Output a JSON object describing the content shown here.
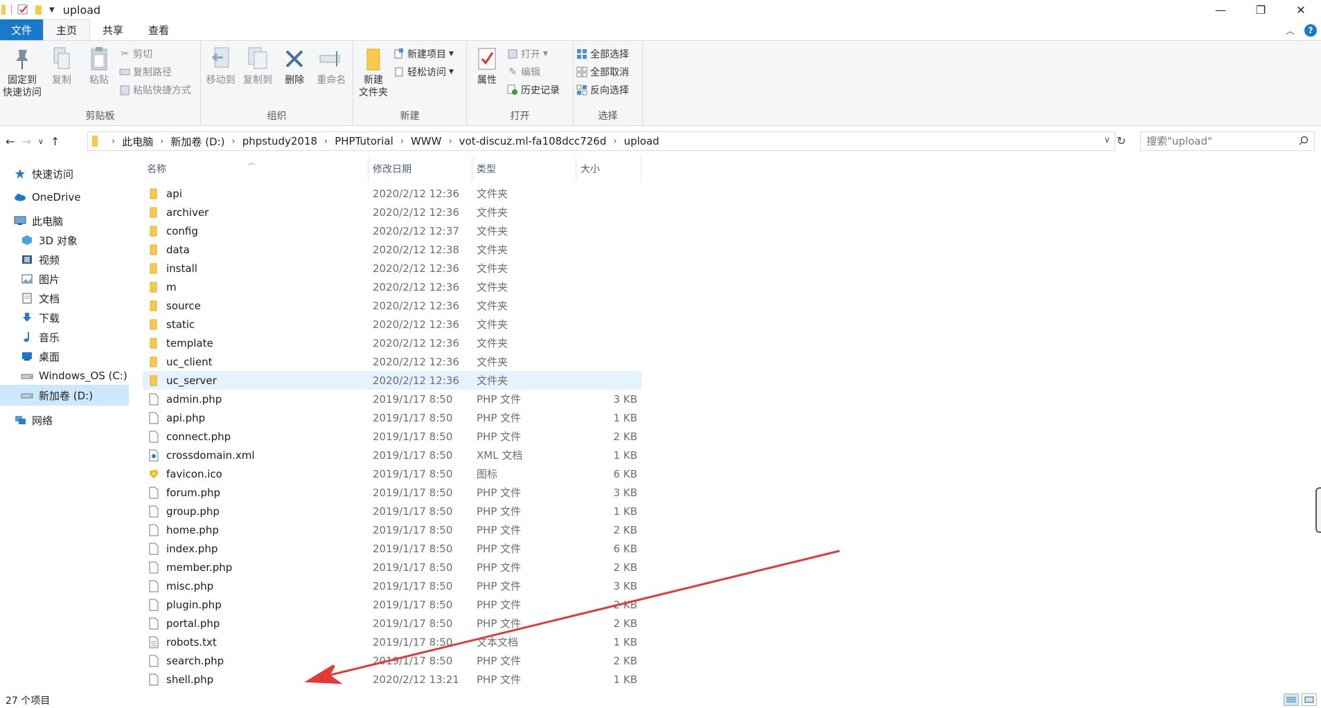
{
  "window": {
    "title": "upload",
    "minimize": "—",
    "maximize": "❐",
    "close": "✕"
  },
  "tabs": [
    {
      "label": "文件"
    },
    {
      "label": "主页"
    },
    {
      "label": "共享"
    },
    {
      "label": "查看"
    }
  ],
  "ribbon": {
    "clipboard": {
      "label": "剪贴板",
      "pin": "固定到\n快速访问",
      "copy": "复制",
      "paste": "粘贴",
      "cut": "剪切",
      "copy_path": "复制路径",
      "paste_shortcut": "粘贴快捷方式"
    },
    "organize": {
      "label": "组织",
      "move_to": "移动到",
      "copy_to": "复制到",
      "delete": "删除",
      "rename": "重命名"
    },
    "new": {
      "label": "新建",
      "new_folder": "新建\n文件夹",
      "new_item": "新建项目",
      "easy_access": "轻松访问"
    },
    "open": {
      "label": "打开",
      "properties": "属性",
      "open": "打开",
      "edit": "编辑",
      "history": "历史记录"
    },
    "select": {
      "label": "选择",
      "select_all": "全部选择",
      "select_none": "全部取消",
      "invert": "反向选择"
    }
  },
  "address": {
    "crumbs": [
      "此电脑",
      "新加卷 (D:)",
      "phpstudy2018",
      "PHPTutorial",
      "WWW",
      "vot-discuz.ml-fa108dcc726d",
      "upload"
    ],
    "search_placeholder": "搜索\"upload\""
  },
  "nav": {
    "items": [
      {
        "label": "快速访问",
        "icon": "star-icon",
        "indent": 0
      },
      {
        "label": "OneDrive",
        "icon": "cloud-icon",
        "indent": 0
      },
      {
        "label": "此电脑",
        "icon": "computer-icon",
        "indent": 0
      },
      {
        "label": "3D 对象",
        "icon": "cube-icon",
        "indent": 1
      },
      {
        "label": "视频",
        "icon": "video-icon",
        "indent": 1
      },
      {
        "label": "图片",
        "icon": "picture-icon",
        "indent": 1
      },
      {
        "label": "文档",
        "icon": "document-icon",
        "indent": 1
      },
      {
        "label": "下载",
        "icon": "download-icon",
        "indent": 1
      },
      {
        "label": "音乐",
        "icon": "music-icon",
        "indent": 1
      },
      {
        "label": "桌面",
        "icon": "desktop-icon",
        "indent": 1
      },
      {
        "label": "Windows_OS (C:)",
        "icon": "drive-icon",
        "indent": 1
      },
      {
        "label": "新加卷 (D:)",
        "icon": "drive-icon",
        "indent": 1
      },
      {
        "label": "网络",
        "icon": "network-icon",
        "indent": 0
      }
    ]
  },
  "columns": {
    "name": "名称",
    "date": "修改日期",
    "type": "类型",
    "size": "大小"
  },
  "files": [
    {
      "name": "api",
      "date": "2020/2/12 12:36",
      "type": "文件夹",
      "size": "",
      "kind": "folder"
    },
    {
      "name": "archiver",
      "date": "2020/2/12 12:36",
      "type": "文件夹",
      "size": "",
      "kind": "folder"
    },
    {
      "name": "config",
      "date": "2020/2/12 12:37",
      "type": "文件夹",
      "size": "",
      "kind": "folder"
    },
    {
      "name": "data",
      "date": "2020/2/12 12:38",
      "type": "文件夹",
      "size": "",
      "kind": "folder"
    },
    {
      "name": "install",
      "date": "2020/2/12 12:36",
      "type": "文件夹",
      "size": "",
      "kind": "folder"
    },
    {
      "name": "m",
      "date": "2020/2/12 12:36",
      "type": "文件夹",
      "size": "",
      "kind": "folder"
    },
    {
      "name": "source",
      "date": "2020/2/12 12:36",
      "type": "文件夹",
      "size": "",
      "kind": "folder"
    },
    {
      "name": "static",
      "date": "2020/2/12 12:36",
      "type": "文件夹",
      "size": "",
      "kind": "folder"
    },
    {
      "name": "template",
      "date": "2020/2/12 12:36",
      "type": "文件夹",
      "size": "",
      "kind": "folder"
    },
    {
      "name": "uc_client",
      "date": "2020/2/12 12:36",
      "type": "文件夹",
      "size": "",
      "kind": "folder"
    },
    {
      "name": "uc_server",
      "date": "2020/2/12 12:36",
      "type": "文件夹",
      "size": "",
      "kind": "folder"
    },
    {
      "name": "admin.php",
      "date": "2019/1/17 8:50",
      "type": "PHP 文件",
      "size": "3 KB",
      "kind": "file"
    },
    {
      "name": "api.php",
      "date": "2019/1/17 8:50",
      "type": "PHP 文件",
      "size": "1 KB",
      "kind": "file"
    },
    {
      "name": "connect.php",
      "date": "2019/1/17 8:50",
      "type": "PHP 文件",
      "size": "2 KB",
      "kind": "file"
    },
    {
      "name": "crossdomain.xml",
      "date": "2019/1/17 8:50",
      "type": "XML 文档",
      "size": "1 KB",
      "kind": "xml"
    },
    {
      "name": "favicon.ico",
      "date": "2019/1/17 8:50",
      "type": "图标",
      "size": "6 KB",
      "kind": "ico"
    },
    {
      "name": "forum.php",
      "date": "2019/1/17 8:50",
      "type": "PHP 文件",
      "size": "3 KB",
      "kind": "file"
    },
    {
      "name": "group.php",
      "date": "2019/1/17 8:50",
      "type": "PHP 文件",
      "size": "1 KB",
      "kind": "file"
    },
    {
      "name": "home.php",
      "date": "2019/1/17 8:50",
      "type": "PHP 文件",
      "size": "2 KB",
      "kind": "file"
    },
    {
      "name": "index.php",
      "date": "2019/1/17 8:50",
      "type": "PHP 文件",
      "size": "6 KB",
      "kind": "file"
    },
    {
      "name": "member.php",
      "date": "2019/1/17 8:50",
      "type": "PHP 文件",
      "size": "2 KB",
      "kind": "file"
    },
    {
      "name": "misc.php",
      "date": "2019/1/17 8:50",
      "type": "PHP 文件",
      "size": "3 KB",
      "kind": "file"
    },
    {
      "name": "plugin.php",
      "date": "2019/1/17 8:50",
      "type": "PHP 文件",
      "size": "2 KB",
      "kind": "file"
    },
    {
      "name": "portal.php",
      "date": "2019/1/17 8:50",
      "type": "PHP 文件",
      "size": "2 KB",
      "kind": "file"
    },
    {
      "name": "robots.txt",
      "date": "2019/1/17 8:50",
      "type": "文本文档",
      "size": "1 KB",
      "kind": "txt"
    },
    {
      "name": "search.php",
      "date": "2019/1/17 8:50",
      "type": "PHP 文件",
      "size": "2 KB",
      "kind": "file"
    },
    {
      "name": "shell.php",
      "date": "2020/2/12 13:21",
      "type": "PHP 文件",
      "size": "1 KB",
      "kind": "file"
    }
  ],
  "highlighted_row": "uc_server",
  "status": {
    "count": "27 个项目"
  },
  "colors": {
    "accent": "#1979ca",
    "folder": "#f8c94a",
    "selection": "#cce8ff",
    "hover": "#e5f3ff",
    "annotation_arrow": "#e53935"
  }
}
